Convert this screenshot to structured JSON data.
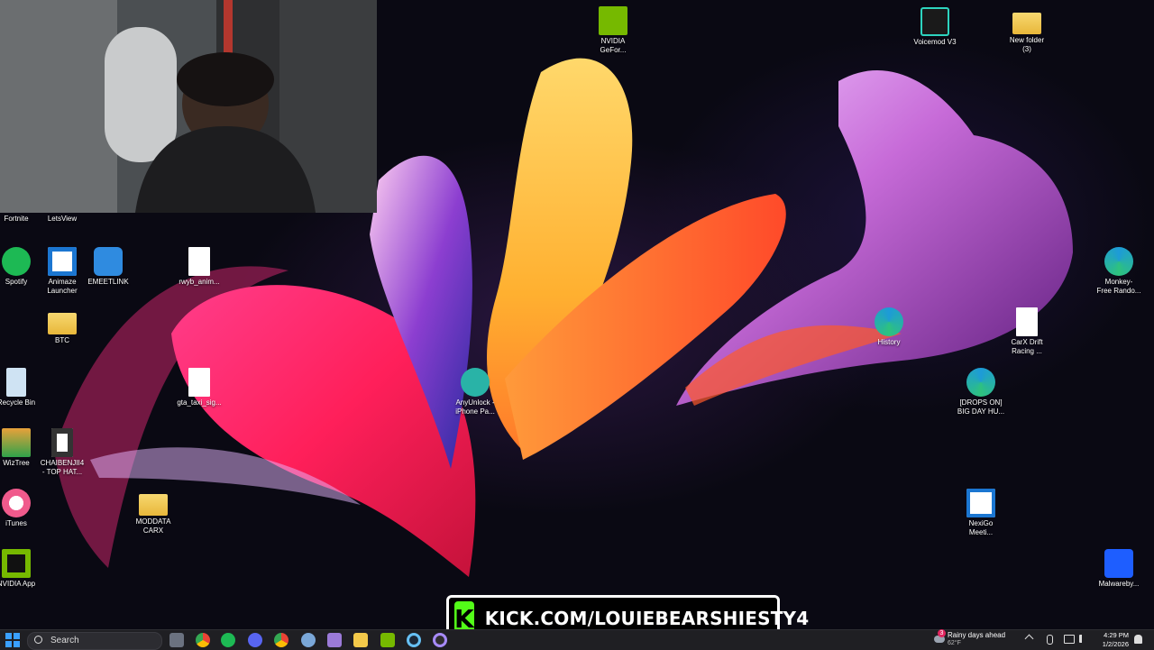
{
  "desktop": {
    "icons": [
      {
        "label": "NVIDIA\nGeFor...",
        "icon": "nvidia-icon",
        "color": "#76b900"
      },
      {
        "label": "Voicemod V3",
        "icon": "voicemod-icon",
        "color": "#1a1a1a"
      },
      {
        "label": "New folder\n(3)",
        "icon": "folder-icon",
        "color": "#f3c94a"
      },
      {
        "label": "Fortnite",
        "icon": "fortnite-icon",
        "color": "#5a5a5a"
      },
      {
        "label": "LetsView",
        "icon": "letsview-icon",
        "color": "#3b82f6"
      },
      {
        "label": "Spotify",
        "icon": "spotify-icon",
        "color": "#1db954"
      },
      {
        "label": "Animaze\nLauncher",
        "icon": "animaze-icon",
        "color": "#ffffff"
      },
      {
        "label": "EMEETLINK",
        "icon": "emeetlink-icon",
        "color": "#2f8be0"
      },
      {
        "label": "rwyb_anim...",
        "icon": "file-icon",
        "color": "#ffffff"
      },
      {
        "label": "BTC",
        "icon": "folder-icon",
        "color": "#f3c94a"
      },
      {
        "label": "Recycle Bin",
        "icon": "recycle-bin-icon",
        "color": "#cfe3f3"
      },
      {
        "label": "gta_taxi_sig...",
        "icon": "file-icon",
        "color": "#ffffff"
      },
      {
        "label": "AnyUnlock -\niPhone Pa...",
        "icon": "anyunlock-icon",
        "color": "#29b3a7"
      },
      {
        "label": "WizTree",
        "icon": "wiztree-icon",
        "color": "#e8a13a"
      },
      {
        "label": "CHAIBENJII4\n- TOP HAT...",
        "icon": "video-file-icon",
        "color": "#ffffff"
      },
      {
        "label": "MODDATA\nCARX",
        "icon": "folder-icon",
        "color": "#f3c94a"
      },
      {
        "label": "iTunes",
        "icon": "itunes-icon",
        "color": "#f05a8c"
      },
      {
        "label": "NVIDIA App",
        "icon": "nvidia-icon",
        "color": "#76b900"
      },
      {
        "label": "History",
        "icon": "edge-icon",
        "color": "#1d9bd8"
      },
      {
        "label": "CarX Drift\nRacing ...",
        "icon": "file-icon",
        "color": "#ffffff"
      },
      {
        "label": "[DROPS ON]\nBIG DAY HU...",
        "icon": "edge-icon",
        "color": "#1d9bd8"
      },
      {
        "label": "Monkey-\nFree Rando...",
        "icon": "edge-icon",
        "color": "#1d9bd8"
      },
      {
        "label": "NexiGo\nMeeti...",
        "icon": "nexigo-icon",
        "color": "#ffffff"
      },
      {
        "label": "Malwareby...",
        "icon": "malwarebytes-icon",
        "color": "#1e5eff"
      }
    ]
  },
  "overlay": {
    "kick_url": "KICK.COM/LOUIEBEARSHIESTY4",
    "kick_logo": "K",
    "brand_color": "#53fc18"
  },
  "taskbar": {
    "search_placeholder": "Search",
    "weather_title": "Rainy days ahead",
    "weather_temp": "62°F",
    "weather_badge": "3",
    "time": "4:29 PM",
    "date": "1/2/2026",
    "pinned": [
      "file-explorer-icon",
      "chrome-icon",
      "spotify-icon",
      "discord-icon",
      "chrome-alt-icon",
      "settings-icon",
      "game-icon",
      "folder-icon",
      "nvidia-icon",
      "steam-icon",
      "obs-icon"
    ]
  }
}
